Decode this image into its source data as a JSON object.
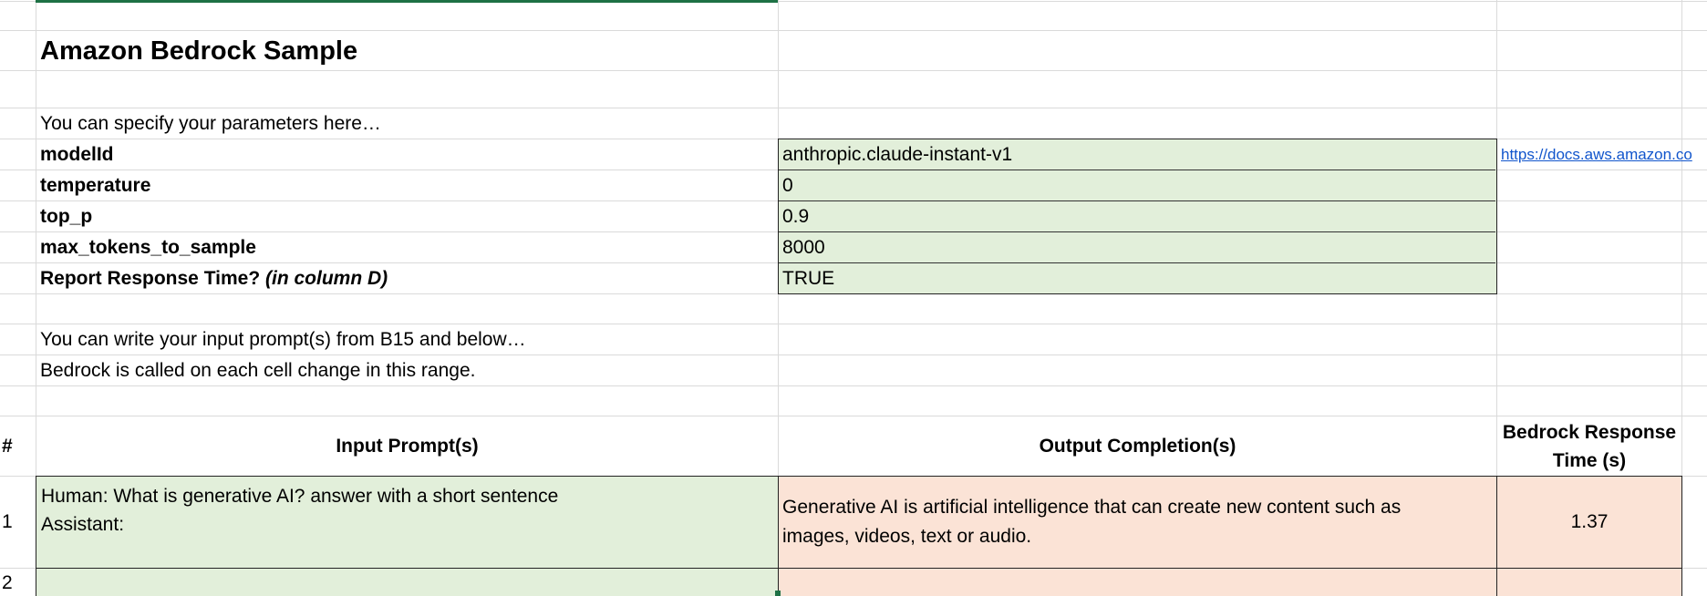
{
  "sheet": {
    "title": "Amazon Bedrock Sample",
    "intro_text": "You can specify your parameters here…",
    "params": [
      {
        "name": "modelId",
        "value": "anthropic.claude-instant-v1"
      },
      {
        "name": "temperature",
        "value": "0"
      },
      {
        "name": "top_p",
        "value": "0.9"
      },
      {
        "name": "max_tokens_to_sample",
        "value": "8000"
      }
    ],
    "report": {
      "name": "Report Response Time?",
      "suffix": "(in column D)",
      "value": "TRUE"
    },
    "doc_link": "https://docs.aws.amazon.co",
    "instruction_1": "You can write your input prompt(s) from B15 and below…",
    "instruction_2": "Bedrock is called on each cell change in this range.",
    "headers": {
      "num": "#",
      "input": "Input Prompt(s)",
      "output": "Output Completion(s)",
      "time": "Bedrock Response Time (s)"
    },
    "rows": [
      {
        "num": "1",
        "input_line1": "Human: What is generative AI? answer with a short sentence",
        "input_line2": "Assistant:",
        "output": " Generative AI is artificial intelligence that can create new content such as images, videos, text or audio.",
        "time": "1.37"
      },
      {
        "num": "2",
        "input_line1": "",
        "input_line2": "",
        "output": "",
        "time": ""
      }
    ]
  },
  "colors": {
    "param_fill": "#e2efda",
    "output_fill": "#fbe3d6",
    "link": "#1155cc"
  }
}
